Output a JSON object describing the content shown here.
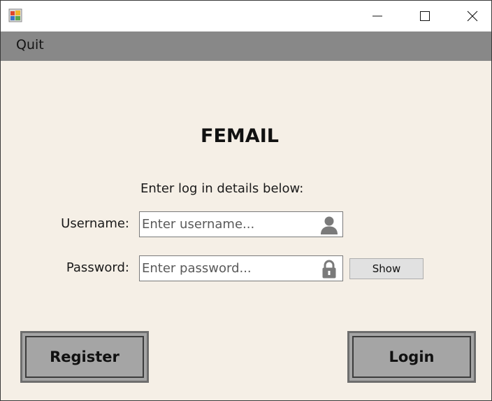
{
  "window": {
    "controls": {
      "minimize": "minimize-icon",
      "maximize": "maximize-icon",
      "close": "close-icon"
    }
  },
  "menu": {
    "quit_label": "Quit"
  },
  "main": {
    "title": "FEMAIL",
    "instructions": "Enter log in details below:",
    "username": {
      "label": "Username:",
      "placeholder": "Enter username...",
      "value": "",
      "icon": "user-icon"
    },
    "password": {
      "label": "Password:",
      "placeholder": "Enter password...",
      "value": "",
      "icon": "lock-icon"
    },
    "show_label": "Show",
    "register_label": "Register",
    "login_label": "Login"
  },
  "colors": {
    "background": "#f5efe6",
    "menubar": "#888888",
    "big_button": "#a5a5a5"
  }
}
